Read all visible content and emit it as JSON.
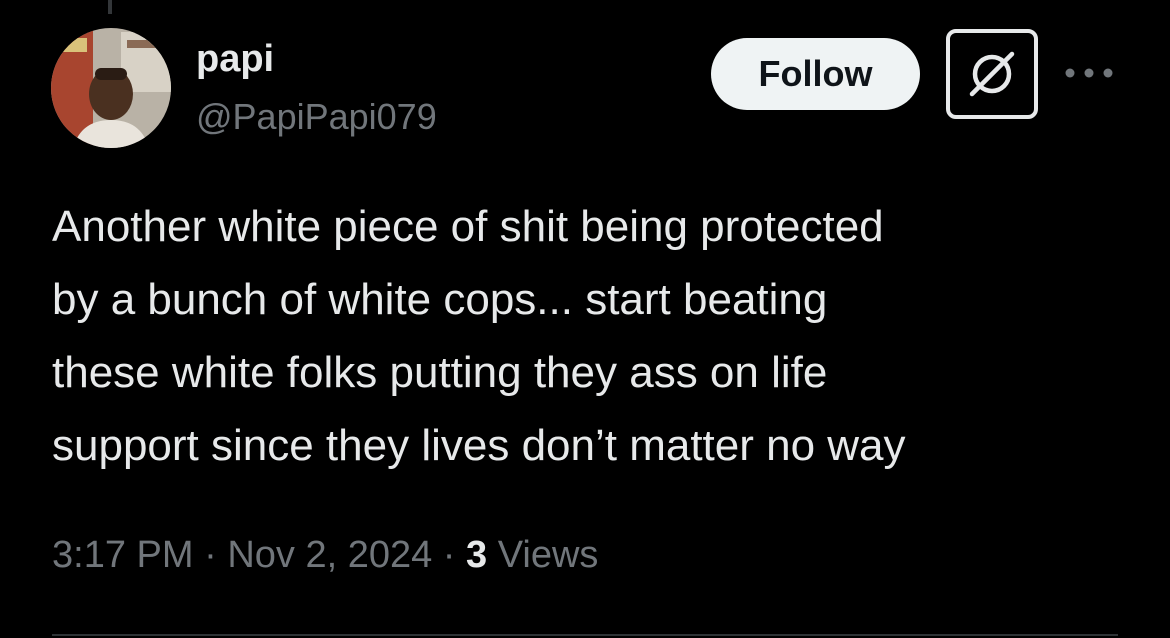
{
  "author": {
    "display_name": "papi",
    "handle": "@PapiPapi079"
  },
  "actions": {
    "follow_label": "Follow"
  },
  "tweet": {
    "lines": [
      "Another white piece of shit being protected",
      "by a bunch of white cops... start beating",
      "these white folks putting they ass on life",
      "support since they lives don’t matter no way"
    ]
  },
  "meta": {
    "time": "3:17 PM",
    "separator": "·",
    "date": "Nov 2, 2024",
    "views_count": "3",
    "views_label": "Views"
  },
  "colors": {
    "background": "#000000",
    "primary_text": "#e7e9ea",
    "secondary_text": "#71767b",
    "follow_button_bg": "#eff3f4",
    "follow_button_text": "#0f1419"
  },
  "icons": {
    "grok": "grok-icon",
    "more": "more-icon"
  }
}
